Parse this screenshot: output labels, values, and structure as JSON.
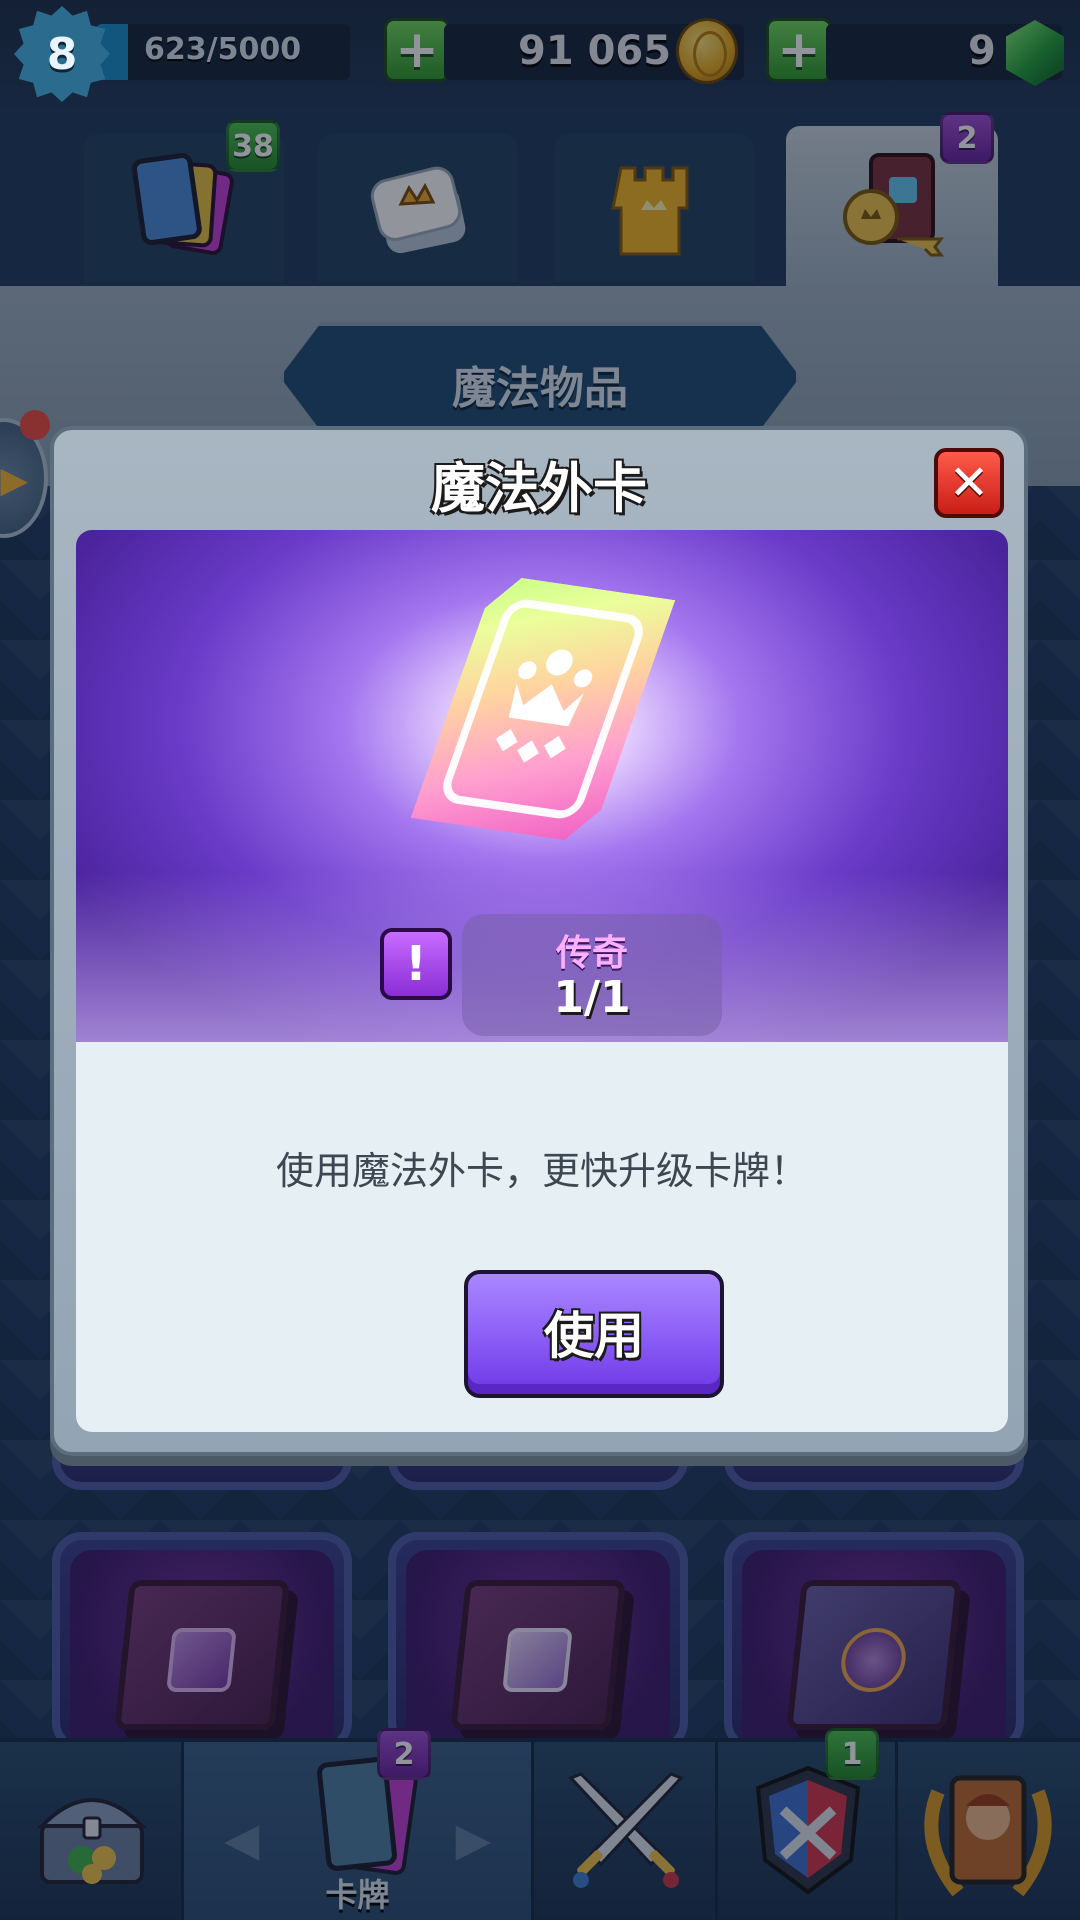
{
  "topbar": {
    "level": "8",
    "xp_text": "623/5000",
    "xp_progress": 0.125,
    "gold": "91 065",
    "gems": "9"
  },
  "tabs": [
    {
      "name": "cards",
      "badge": "38",
      "badge_color": "#2f9b2a"
    },
    {
      "name": "emotes",
      "badge": ""
    },
    {
      "name": "towers",
      "badge": ""
    },
    {
      "name": "magic-items",
      "badge": "2",
      "badge_color": "#6a22a0"
    }
  ],
  "section": {
    "title": "魔法物品"
  },
  "modal": {
    "title": "魔法外卡",
    "rarity": "传奇",
    "count": "1/1",
    "description": "使用魔法外卡，更快升级卡牌！",
    "use_label": "使用",
    "close_symbol": "✕",
    "info_symbol": "!",
    "accent": "#8a5cf6"
  },
  "bottom_nav": {
    "cards_label": "卡牌",
    "cards_badge": "2",
    "clan_badge": "1"
  }
}
